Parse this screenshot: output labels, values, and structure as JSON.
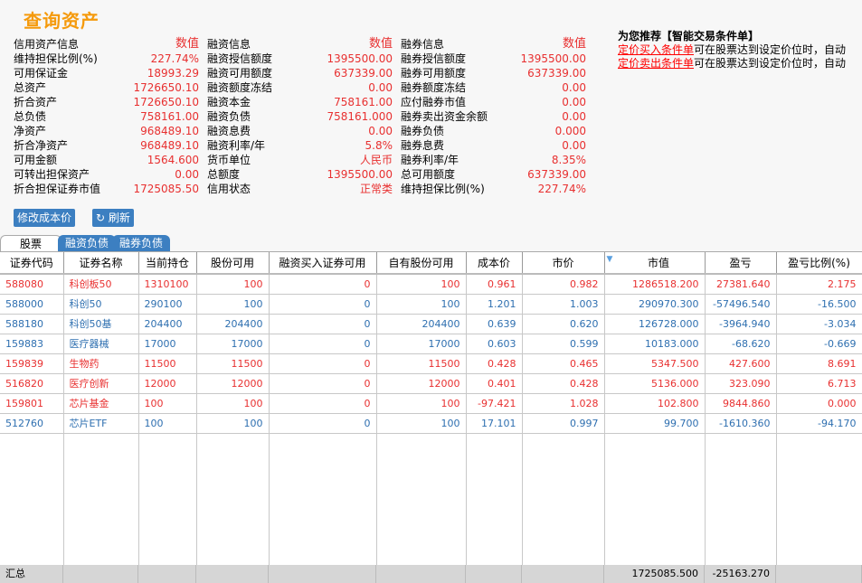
{
  "title": "查询资产",
  "info": {
    "headers": [
      "信用资产信息",
      "数值",
      "融资信息",
      "数值",
      "融券信息",
      "数值"
    ],
    "rows": [
      [
        "维持担保比例(%)",
        "227.74%",
        "融资授信额度",
        "1395500.00",
        "融券授信额度",
        "1395500.00"
      ],
      [
        "可用保证金",
        "18993.29",
        "融资可用额度",
        "637339.00",
        "融券可用额度",
        "637339.00"
      ],
      [
        "总资产",
        "1726650.10",
        "融资额度冻结",
        "0.00",
        "融券额度冻结",
        "0.00"
      ],
      [
        "折合资产",
        "1726650.10",
        "融资本金",
        "758161.00",
        "应付融券市值",
        "0.00"
      ],
      [
        "总负债",
        "758161.00",
        "融资负债",
        "758161.000",
        "融券卖出资金余额",
        "0.00"
      ],
      [
        "净资产",
        "968489.10",
        "融资息费",
        "0.00",
        "融券负债",
        "0.000"
      ],
      [
        "折合净资产",
        "968489.10",
        "融资利率/年",
        "5.8%",
        "融券息费",
        "0.00"
      ],
      [
        "可用金额",
        "1564.600",
        "货币单位",
        "人民币",
        "融券利率/年",
        "8.35%"
      ],
      [
        "可转出担保资产",
        "0.00",
        "总额度",
        "1395500.00",
        "总可用额度",
        "637339.00"
      ],
      [
        "折合担保证券市值",
        "1725085.50",
        "信用状态",
        "正常类",
        "维持担保比例(%)",
        "227.74%"
      ]
    ]
  },
  "recommend": {
    "heading": "为您推荐【智能交易条件单】",
    "links": [
      {
        "link": "定价买入条件单",
        "text": "可在股票达到设定价位时，自动"
      },
      {
        "link": "定价卖出条件单",
        "text": "可在股票达到设定价位时，自动"
      }
    ]
  },
  "buttons": {
    "modify_cost": "修改成本价",
    "refresh": "刷新"
  },
  "tabs": [
    "股票",
    "融资负债",
    "融券负债"
  ],
  "table": {
    "columns": [
      "证券代码",
      "证券名称",
      "当前持仓",
      "股份可用",
      "融资买入证券可用",
      "自有股份可用",
      "成本价",
      "市价",
      "市值",
      "盈亏",
      "盈亏比例(%)"
    ],
    "rows": [
      {
        "c": "r",
        "v": [
          "588080",
          "科创板50",
          "1310100",
          "100",
          "0",
          "100",
          "0.961",
          "0.982",
          "1286518.200",
          "27381.640",
          "2.175"
        ]
      },
      {
        "c": "b",
        "v": [
          "588000",
          "科创50",
          "290100",
          "100",
          "0",
          "100",
          "1.201",
          "1.003",
          "290970.300",
          "-57496.540",
          "-16.500"
        ]
      },
      {
        "c": "b",
        "v": [
          "588180",
          "科创50基",
          "204400",
          "204400",
          "0",
          "204400",
          "0.639",
          "0.620",
          "126728.000",
          "-3964.940",
          "-3.034"
        ]
      },
      {
        "c": "b",
        "v": [
          "159883",
          "医疗器械",
          "17000",
          "17000",
          "0",
          "17000",
          "0.603",
          "0.599",
          "10183.000",
          "-68.620",
          "-0.669"
        ]
      },
      {
        "c": "r",
        "v": [
          "159839",
          "生物药",
          "11500",
          "11500",
          "0",
          "11500",
          "0.428",
          "0.465",
          "5347.500",
          "427.600",
          "8.691"
        ]
      },
      {
        "c": "r",
        "v": [
          "516820",
          "医疗创新",
          "12000",
          "12000",
          "0",
          "12000",
          "0.401",
          "0.428",
          "5136.000",
          "323.090",
          "6.713"
        ]
      },
      {
        "c": "r",
        "v": [
          "159801",
          "芯片基金",
          "100",
          "100",
          "0",
          "100",
          "-97.421",
          "1.028",
          "102.800",
          "9844.860",
          "0.000"
        ]
      },
      {
        "c": "b",
        "v": [
          "512760",
          "芯片ETF",
          "100",
          "100",
          "0",
          "100",
          "17.101",
          "0.997",
          "99.700",
          "-1610.360",
          "-94.170"
        ]
      }
    ],
    "footer": {
      "label": "汇总",
      "market_value": "1725085.500",
      "profit": "-25163.270"
    }
  }
}
